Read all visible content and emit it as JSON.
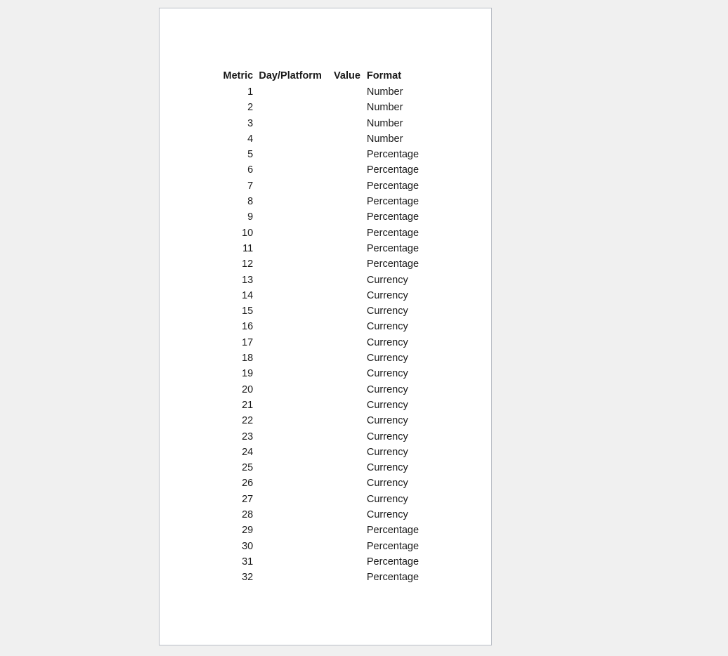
{
  "page": {
    "background_color": "#f0f0f0",
    "sheet_color": "#ffffff",
    "border_color": "#b9bdc5",
    "text_color": "#1a1a1a"
  },
  "table": {
    "headers": {
      "metric": "Metric",
      "day_platform": "Day/Platform",
      "value": "Value",
      "format": "Format"
    },
    "rows": [
      {
        "metric": "1",
        "day_platform": "",
        "value": "",
        "format": "Number"
      },
      {
        "metric": "2",
        "day_platform": "",
        "value": "",
        "format": "Number"
      },
      {
        "metric": "3",
        "day_platform": "",
        "value": "",
        "format": "Number"
      },
      {
        "metric": "4",
        "day_platform": "",
        "value": "",
        "format": "Number"
      },
      {
        "metric": "5",
        "day_platform": "",
        "value": "",
        "format": "Percentage"
      },
      {
        "metric": "6",
        "day_platform": "",
        "value": "",
        "format": "Percentage"
      },
      {
        "metric": "7",
        "day_platform": "",
        "value": "",
        "format": "Percentage"
      },
      {
        "metric": "8",
        "day_platform": "",
        "value": "",
        "format": "Percentage"
      },
      {
        "metric": "9",
        "day_platform": "",
        "value": "",
        "format": "Percentage"
      },
      {
        "metric": "10",
        "day_platform": "",
        "value": "",
        "format": "Percentage"
      },
      {
        "metric": "11",
        "day_platform": "",
        "value": "",
        "format": "Percentage"
      },
      {
        "metric": "12",
        "day_platform": "",
        "value": "",
        "format": "Percentage"
      },
      {
        "metric": "13",
        "day_platform": "",
        "value": "",
        "format": "Currency"
      },
      {
        "metric": "14",
        "day_platform": "",
        "value": "",
        "format": "Currency"
      },
      {
        "metric": "15",
        "day_platform": "",
        "value": "",
        "format": "Currency"
      },
      {
        "metric": "16",
        "day_platform": "",
        "value": "",
        "format": "Currency"
      },
      {
        "metric": "17",
        "day_platform": "",
        "value": "",
        "format": "Currency"
      },
      {
        "metric": "18",
        "day_platform": "",
        "value": "",
        "format": "Currency"
      },
      {
        "metric": "19",
        "day_platform": "",
        "value": "",
        "format": "Currency"
      },
      {
        "metric": "20",
        "day_platform": "",
        "value": "",
        "format": "Currency"
      },
      {
        "metric": "21",
        "day_platform": "",
        "value": "",
        "format": "Currency"
      },
      {
        "metric": "22",
        "day_platform": "",
        "value": "",
        "format": "Currency"
      },
      {
        "metric": "23",
        "day_platform": "",
        "value": "",
        "format": "Currency"
      },
      {
        "metric": "24",
        "day_platform": "",
        "value": "",
        "format": "Currency"
      },
      {
        "metric": "25",
        "day_platform": "",
        "value": "",
        "format": "Currency"
      },
      {
        "metric": "26",
        "day_platform": "",
        "value": "",
        "format": "Currency"
      },
      {
        "metric": "27",
        "day_platform": "",
        "value": "",
        "format": "Currency"
      },
      {
        "metric": "28",
        "day_platform": "",
        "value": "",
        "format": "Currency"
      },
      {
        "metric": "29",
        "day_platform": "",
        "value": "",
        "format": "Percentage"
      },
      {
        "metric": "30",
        "day_platform": "",
        "value": "",
        "format": "Percentage"
      },
      {
        "metric": "31",
        "day_platform": "",
        "value": "",
        "format": "Percentage"
      },
      {
        "metric": "32",
        "day_platform": "",
        "value": "",
        "format": "Percentage"
      }
    ]
  }
}
